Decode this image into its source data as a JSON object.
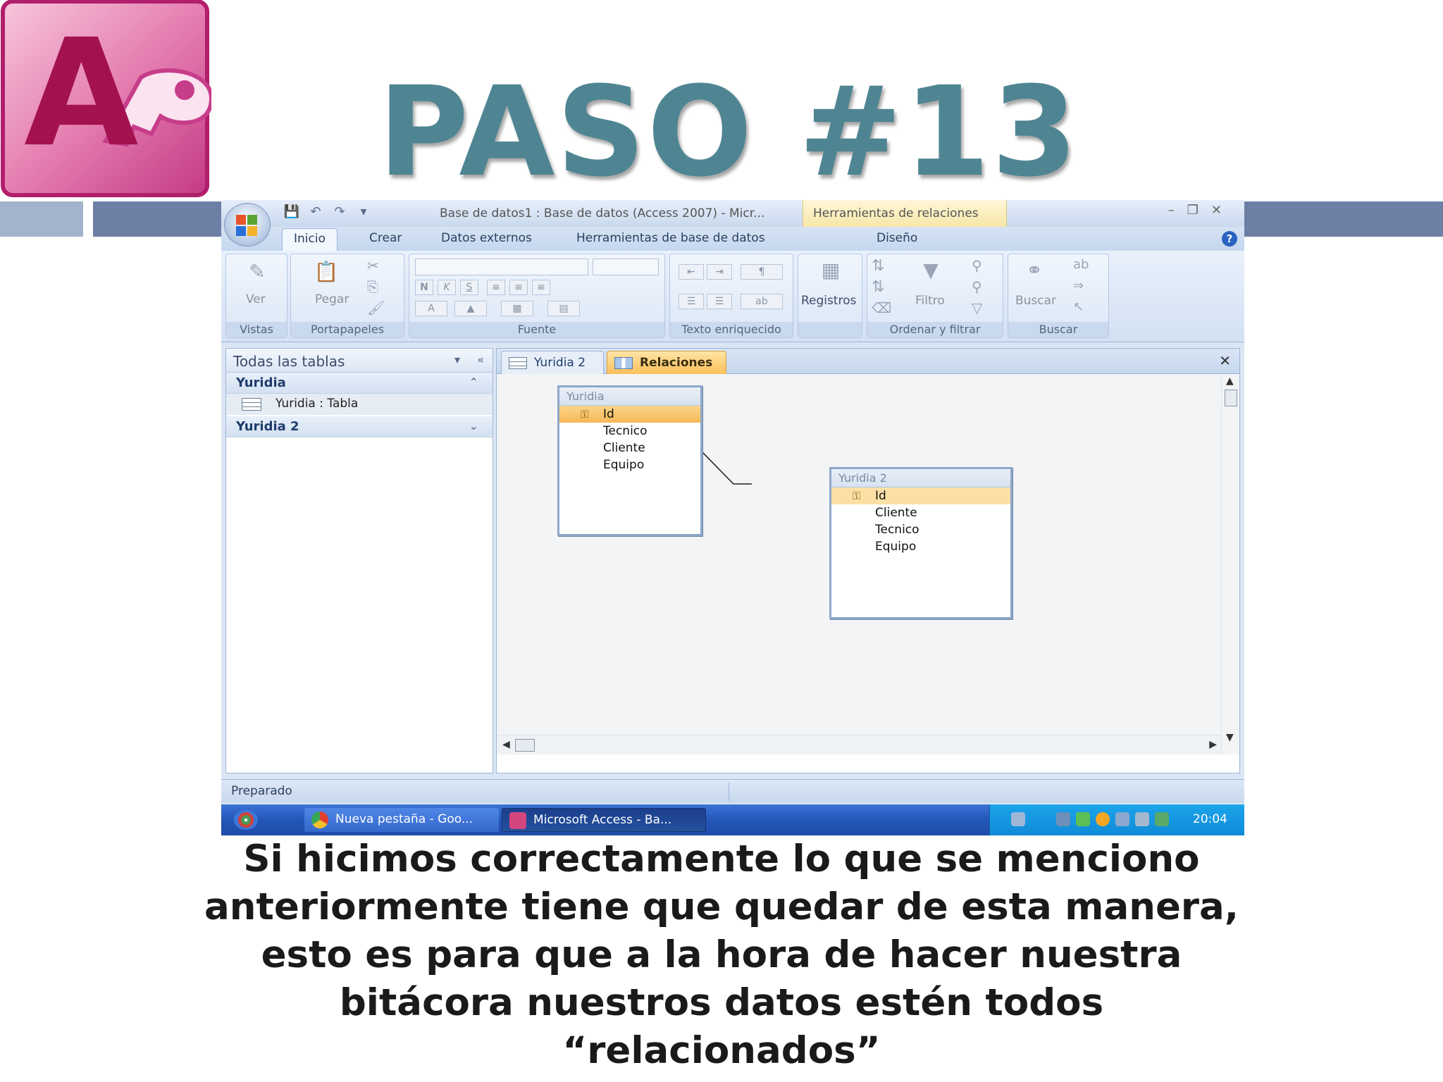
{
  "slide": {
    "title": "PASO #13",
    "caption_lines": [
      "Si hicimos correctamente lo que se menciono",
      "anteriormente tiene que quedar de esta manera,",
      "esto es para que a la hora de hacer nuestra",
      "bitácora nuestros datos estén todos",
      "“relacionados”"
    ],
    "logo_letter": "A"
  },
  "window": {
    "title": "Base de datos1 : Base de datos (Access 2007) - Micr...",
    "context_tab": "Herramientas de relaciones",
    "controls": [
      "–",
      "❐",
      "✕"
    ]
  },
  "ribbon": {
    "tabs": [
      "Inicio",
      "Crear",
      "Datos externos",
      "Herramientas de base de datos",
      "Diseño"
    ],
    "active_tab": "Inicio",
    "groups": {
      "vistas": {
        "label": "Vistas",
        "button": "Ver"
      },
      "portapapeles": {
        "label": "Portapapeles",
        "button": "Pegar"
      },
      "fuente": {
        "label": "Fuente",
        "bold": "N",
        "italic": "K",
        "underline": "S",
        "font_color": "A"
      },
      "texto": {
        "label": "Texto enriquecido"
      },
      "registros": {
        "label": "",
        "button": "Registros"
      },
      "ordenar": {
        "label": "Ordenar y filtrar",
        "button": "Filtro"
      },
      "buscar": {
        "label": "Buscar",
        "button": "Buscar"
      }
    }
  },
  "nav": {
    "header": "Todas las tablas",
    "groups": [
      {
        "name": "Yuridia",
        "items": [
          "Yuridia : Tabla"
        ]
      },
      {
        "name": "Yuridia 2",
        "items": []
      }
    ]
  },
  "doc": {
    "tabs": [
      "Yuridia 2",
      "Relaciones"
    ],
    "active_tab": "Relaciones",
    "tables": [
      {
        "name": "Yuridia",
        "fields": [
          "Id",
          "Tecnico",
          "Cliente",
          "Equipo"
        ],
        "primary_key": "Id"
      },
      {
        "name": "Yuridia 2",
        "fields": [
          "Id",
          "Cliente",
          "Tecnico",
          "Equipo"
        ],
        "primary_key": "Id"
      }
    ]
  },
  "status": {
    "text": "Preparado"
  },
  "taskbar": {
    "tasks": [
      "Nueva pestaña - Goo...",
      "Microsoft Access - Ba..."
    ],
    "clock": "20:04"
  },
  "colors": {
    "title": "#4f8593",
    "accent_band": "#6e7fa6",
    "relationship_highlight": "#f6b756",
    "taskbar": "#2456b8"
  }
}
